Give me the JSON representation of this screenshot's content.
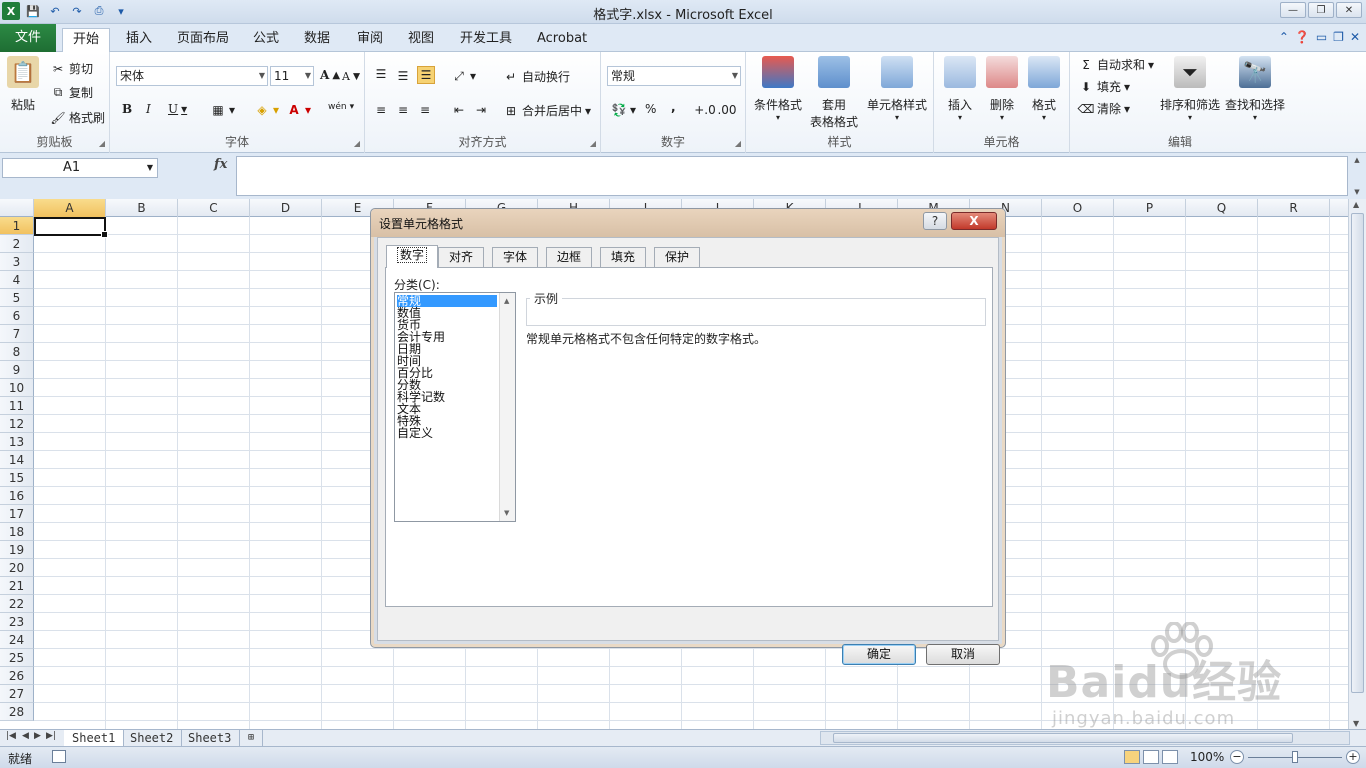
{
  "window": {
    "title": "格式字.xlsx - Microsoft Excel",
    "app_icon_letter": "X",
    "minimize": "—",
    "restore": "❐",
    "close": "✕"
  },
  "ribbon_tabs": [
    {
      "label": "文件"
    },
    {
      "label": "开始"
    },
    {
      "label": "插入"
    },
    {
      "label": "页面布局"
    },
    {
      "label": "公式"
    },
    {
      "label": "数据"
    },
    {
      "label": "审阅"
    },
    {
      "label": "视图"
    },
    {
      "label": "开发工具"
    },
    {
      "label": "Acrobat"
    }
  ],
  "active_tab": "开始",
  "groups": {
    "clipboard": {
      "label": "剪贴板",
      "paste": "粘贴",
      "cut": "剪切",
      "copy": "复制",
      "format_painter": "格式刷"
    },
    "font": {
      "label": "字体",
      "font_name": "宋体",
      "font_size": "11",
      "bold": "B",
      "italic": "I",
      "underline": "U",
      "grow": "A",
      "shrink": "A",
      "wen": "wén"
    },
    "alignment": {
      "label": "对齐方式",
      "wrap": "自动换行",
      "merge": "合并后居中"
    },
    "number": {
      "label": "数字",
      "format": "常规",
      "percent": "%",
      "comma": ","
    },
    "styles": {
      "label": "样式",
      "conditional": "条件格式",
      "table_1": "套用",
      "table_2": "表格格式",
      "cell_styles": "单元格样式"
    },
    "cells": {
      "label": "单元格",
      "insert": "插入",
      "delete": "删除",
      "format": "格式"
    },
    "editing": {
      "label": "编辑",
      "autosum": "自动求和",
      "fill": "填充",
      "clear": "清除",
      "sort": "排序和筛选",
      "find": "查找和选择"
    }
  },
  "formula_bar": {
    "name_box": "A1",
    "fx": "fx"
  },
  "columns": [
    "A",
    "B",
    "C",
    "D",
    "E",
    "F",
    "G",
    "H",
    "I",
    "J",
    "K",
    "L",
    "M",
    "N",
    "O",
    "P",
    "Q",
    "R"
  ],
  "rows": [
    "1",
    "2",
    "3",
    "4",
    "5",
    "6",
    "7",
    "8",
    "9",
    "10",
    "11",
    "12",
    "13",
    "14",
    "15",
    "16",
    "17",
    "18",
    "19",
    "20",
    "21",
    "22",
    "23",
    "24",
    "25",
    "26",
    "27",
    "28"
  ],
  "sheets": [
    "Sheet1",
    "Sheet2",
    "Sheet3"
  ],
  "status": {
    "ready": "就绪",
    "zoom": "100%",
    "zoom_minus": "−",
    "zoom_plus": "+"
  },
  "dialog": {
    "title": "设置单元格格式",
    "help": "?",
    "close": "X",
    "tabs": [
      "数字",
      "对齐",
      "字体",
      "边框",
      "填充",
      "保护"
    ],
    "category_label": "分类(C):",
    "categories": [
      "常规",
      "数值",
      "货币",
      "会计专用",
      "日期",
      "时间",
      "百分比",
      "分数",
      "科学记数",
      "文本",
      "特殊",
      "自定义"
    ],
    "selected_category": "常规",
    "sample_label": "示例",
    "description": "常规单元格格式不包含任何特定的数字格式。",
    "ok": "确定",
    "cancel": "取消"
  },
  "watermark": {
    "main": "Bai",
    "main2": "du",
    "cn": "经验",
    "sub": "jingyan.baidu.com"
  }
}
